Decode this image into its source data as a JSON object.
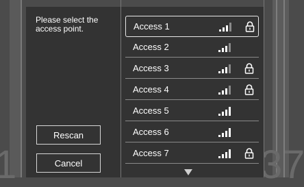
{
  "prompt": "Please select the access point.",
  "buttons": {
    "rescan": "Rescan",
    "cancel": "Cancel"
  },
  "access_points": [
    {
      "name": "Access 1",
      "signal_bars": 3,
      "locked": true,
      "selected": true
    },
    {
      "name": "Access 2",
      "signal_bars": 3,
      "locked": false,
      "selected": false
    },
    {
      "name": "Access 3",
      "signal_bars": 3,
      "locked": true,
      "selected": false
    },
    {
      "name": "Access 4",
      "signal_bars": 3,
      "locked": true,
      "selected": false
    },
    {
      "name": "Access 5",
      "signal_bars": 4,
      "locked": false,
      "selected": false
    },
    {
      "name": "Access 6",
      "signal_bars": 4,
      "locked": false,
      "selected": false
    },
    {
      "name": "Access 7",
      "signal_bars": 4,
      "locked": true,
      "selected": false
    }
  ],
  "background_digits": [
    "1",
    "3",
    "7"
  ],
  "icons": {
    "lock": "lock-icon",
    "signal": "wifi-signal-icon",
    "scroll_down": "scroll-down-arrow-icon"
  },
  "colors": {
    "background": "#4b4b4b",
    "panel": "#333333",
    "text": "#ffffff"
  }
}
